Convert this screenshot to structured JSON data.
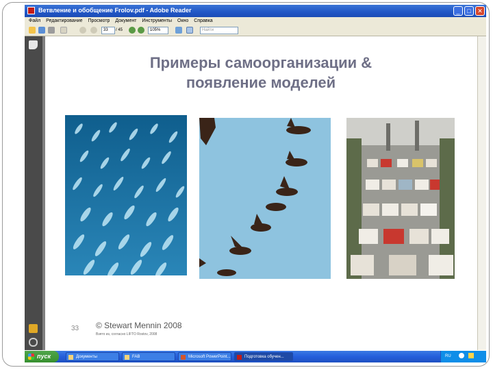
{
  "window": {
    "title": "Ветвление и обобщение Frolov.pdf - Adobe Reader",
    "minimize": "_",
    "maximize": "□",
    "close": "✕"
  },
  "menubar": [
    "Файл",
    "Редактирование",
    "Просмотр",
    "Документ",
    "Инструменты",
    "Окно",
    "Справка"
  ],
  "toolbar": {
    "page_current": "33",
    "page_total": "/ 45",
    "zoom": "105%",
    "search_placeholder": "Найти"
  },
  "slide": {
    "title_line1": "Примеры самоорганизации &",
    "title_line2": "появление моделей",
    "page_number": "33",
    "copyright": "© Stewart Mennin 2008",
    "subcopy": "Взято из, согласно LIFTO Rostov, 2008"
  },
  "photos": [
    {
      "subject": "school-of-fish",
      "color": "#2a7fb0"
    },
    {
      "subject": "flock-of-geese",
      "color": "#8ec3df"
    },
    {
      "subject": "traffic-jam",
      "color": "#8a8a8a"
    }
  ],
  "taskbar": {
    "start_label": "пуск",
    "tasks": [
      "Документы",
      "FAB",
      "Microsoft PowerPoint...",
      "Подготовка обучен..."
    ],
    "tray_lang": "RU"
  },
  "colors": {
    "title_text": "#6e6f86",
    "titlebar": "#2156c6",
    "nav_pane": "#4a4a4a",
    "taskbar": "#245edb"
  }
}
